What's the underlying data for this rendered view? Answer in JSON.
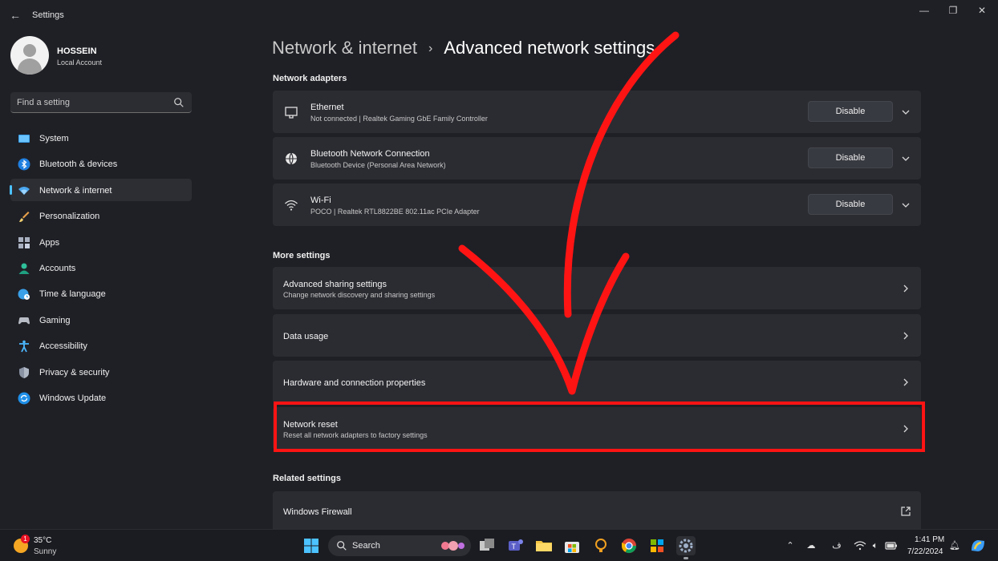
{
  "window": {
    "title": "Settings",
    "minimize": "—",
    "maximize": "❐",
    "close": "✕",
    "back": "←"
  },
  "profile": {
    "name": "HOSSEIN",
    "account_type": "Local Account"
  },
  "search": {
    "placeholder": "Find a setting"
  },
  "sidebar": {
    "items": [
      {
        "label": "System",
        "icon": "monitor-icon"
      },
      {
        "label": "Bluetooth & devices",
        "icon": "bluetooth-icon"
      },
      {
        "label": "Network & internet",
        "icon": "wifi-icon",
        "active": true
      },
      {
        "label": "Personalization",
        "icon": "brush-icon"
      },
      {
        "label": "Apps",
        "icon": "apps-icon"
      },
      {
        "label": "Accounts",
        "icon": "person-icon"
      },
      {
        "label": "Time & language",
        "icon": "globe-clock-icon"
      },
      {
        "label": "Gaming",
        "icon": "gamepad-icon"
      },
      {
        "label": "Accessibility",
        "icon": "accessibility-icon"
      },
      {
        "label": "Privacy & security",
        "icon": "shield-icon"
      },
      {
        "label": "Windows Update",
        "icon": "update-icon"
      }
    ]
  },
  "header": {
    "parent": "Network & internet",
    "separator": "›",
    "current": "Advanced network settings"
  },
  "network_adapters": {
    "title": "Network adapters",
    "items": [
      {
        "name": "Ethernet",
        "description": "Not connected | Realtek Gaming GbE Family Controller",
        "button": "Disable",
        "icon": "ethernet-icon"
      },
      {
        "name": "Bluetooth Network Connection",
        "description": "Bluetooth Device (Personal Area Network)",
        "button": "Disable",
        "icon": "globe-icon"
      },
      {
        "name": "Wi-Fi",
        "description": "POCO | Realtek RTL8822BE 802.11ac PCIe Adapter",
        "button": "Disable",
        "icon": "wifi-icon"
      }
    ]
  },
  "more_settings": {
    "title": "More settings",
    "items": [
      {
        "name": "Advanced sharing settings",
        "description": "Change network discovery and sharing settings"
      },
      {
        "name": "Data usage",
        "description": ""
      },
      {
        "name": "Hardware and connection properties",
        "description": ""
      },
      {
        "name": "Network reset",
        "description": "Reset all network adapters to factory settings",
        "highlighted": true
      }
    ]
  },
  "related_settings": {
    "title": "Related settings",
    "items": [
      {
        "name": "Windows Firewall",
        "icon": "external-link-icon"
      }
    ]
  },
  "taskbar": {
    "weather_temp": "35°C",
    "weather_condition": "Sunny",
    "weather_badge": "1",
    "search_label": "Search",
    "time": "1:41 PM",
    "date": "7/22/2024"
  },
  "colors": {
    "accent": "#4cc2ff",
    "highlight": "#ff1414",
    "card": "#2b2c32",
    "background": "#1f2026"
  }
}
